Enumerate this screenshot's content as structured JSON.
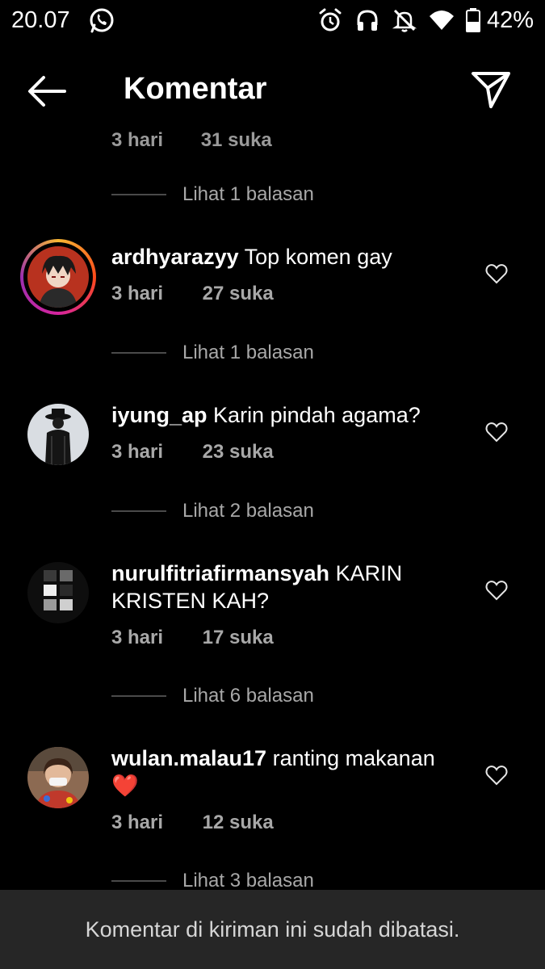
{
  "status_bar": {
    "time": "20.07",
    "icons": [
      "whatsapp-icon",
      "alarm-icon",
      "headset-icon",
      "notifications-off-icon",
      "wifi-icon",
      "battery-icon"
    ],
    "battery_percent": "42%"
  },
  "header": {
    "title": "Komentar",
    "back_icon": "arrow-left-icon",
    "share_icon": "send-icon"
  },
  "partial_comment": {
    "time": "3 hari",
    "likes": "31 suka",
    "replies": "Lihat 1 balasan"
  },
  "comments": [
    {
      "username": "ardhyarazyy",
      "text": "Top komen gay",
      "time": "3 hari",
      "likes": "27 suka",
      "replies": "Lihat 1 balasan",
      "has_story_ring": true
    },
    {
      "username": "iyung_ap",
      "text": "Karin pindah agama?",
      "time": "3 hari",
      "likes": "23 suka",
      "replies": "Lihat 2 balasan",
      "has_story_ring": false
    },
    {
      "username": "nurulfitriafirmansyah",
      "text": "KARIN KRISTEN KAH?",
      "time": "3 hari",
      "likes": "17 suka",
      "replies": "Lihat 6 balasan",
      "has_story_ring": false
    },
    {
      "username": "wulan.malau17",
      "text": "ranting makanan ❤️",
      "time": "3 hari",
      "likes": "12 suka",
      "replies": "Lihat 3 balasan",
      "has_story_ring": false
    }
  ],
  "colors": {
    "background": "#000000",
    "secondary_text": "#a8a8a8",
    "banner_bg": "#262626",
    "heart_red": "#e0242a"
  },
  "banner": {
    "text": "Komentar di kiriman ini sudah dibatasi."
  }
}
